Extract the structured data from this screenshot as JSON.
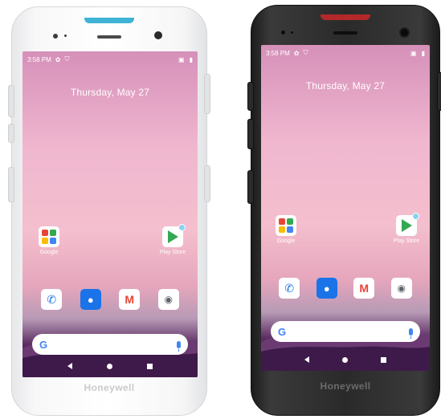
{
  "devices": [
    {
      "variant": "white",
      "status_time": "3:58 PM",
      "date": "Thursday, May 27",
      "home_apps": [
        {
          "label": "Google",
          "icon": "google-folder-icon"
        },
        {
          "label": "Play Store",
          "icon": "play-store-icon"
        }
      ],
      "dock_apps": [
        {
          "icon": "phone-icon"
        },
        {
          "icon": "contacts-icon"
        },
        {
          "icon": "gmail-icon"
        },
        {
          "icon": "camera-icon"
        }
      ],
      "search_logo": "G",
      "brand": "Honeywell",
      "accent_color": "#3fb3d6"
    },
    {
      "variant": "black",
      "status_time": "3:58 PM",
      "date": "Thursday, May 27",
      "home_apps": [
        {
          "label": "Google",
          "icon": "google-folder-icon"
        },
        {
          "label": "Play Store",
          "icon": "play-store-icon"
        }
      ],
      "dock_apps": [
        {
          "icon": "phone-icon"
        },
        {
          "icon": "contacts-icon"
        },
        {
          "icon": "gmail-icon"
        },
        {
          "icon": "camera-icon"
        }
      ],
      "search_logo": "G",
      "brand": "Honeywell",
      "accent_color": "#b32828"
    }
  ]
}
